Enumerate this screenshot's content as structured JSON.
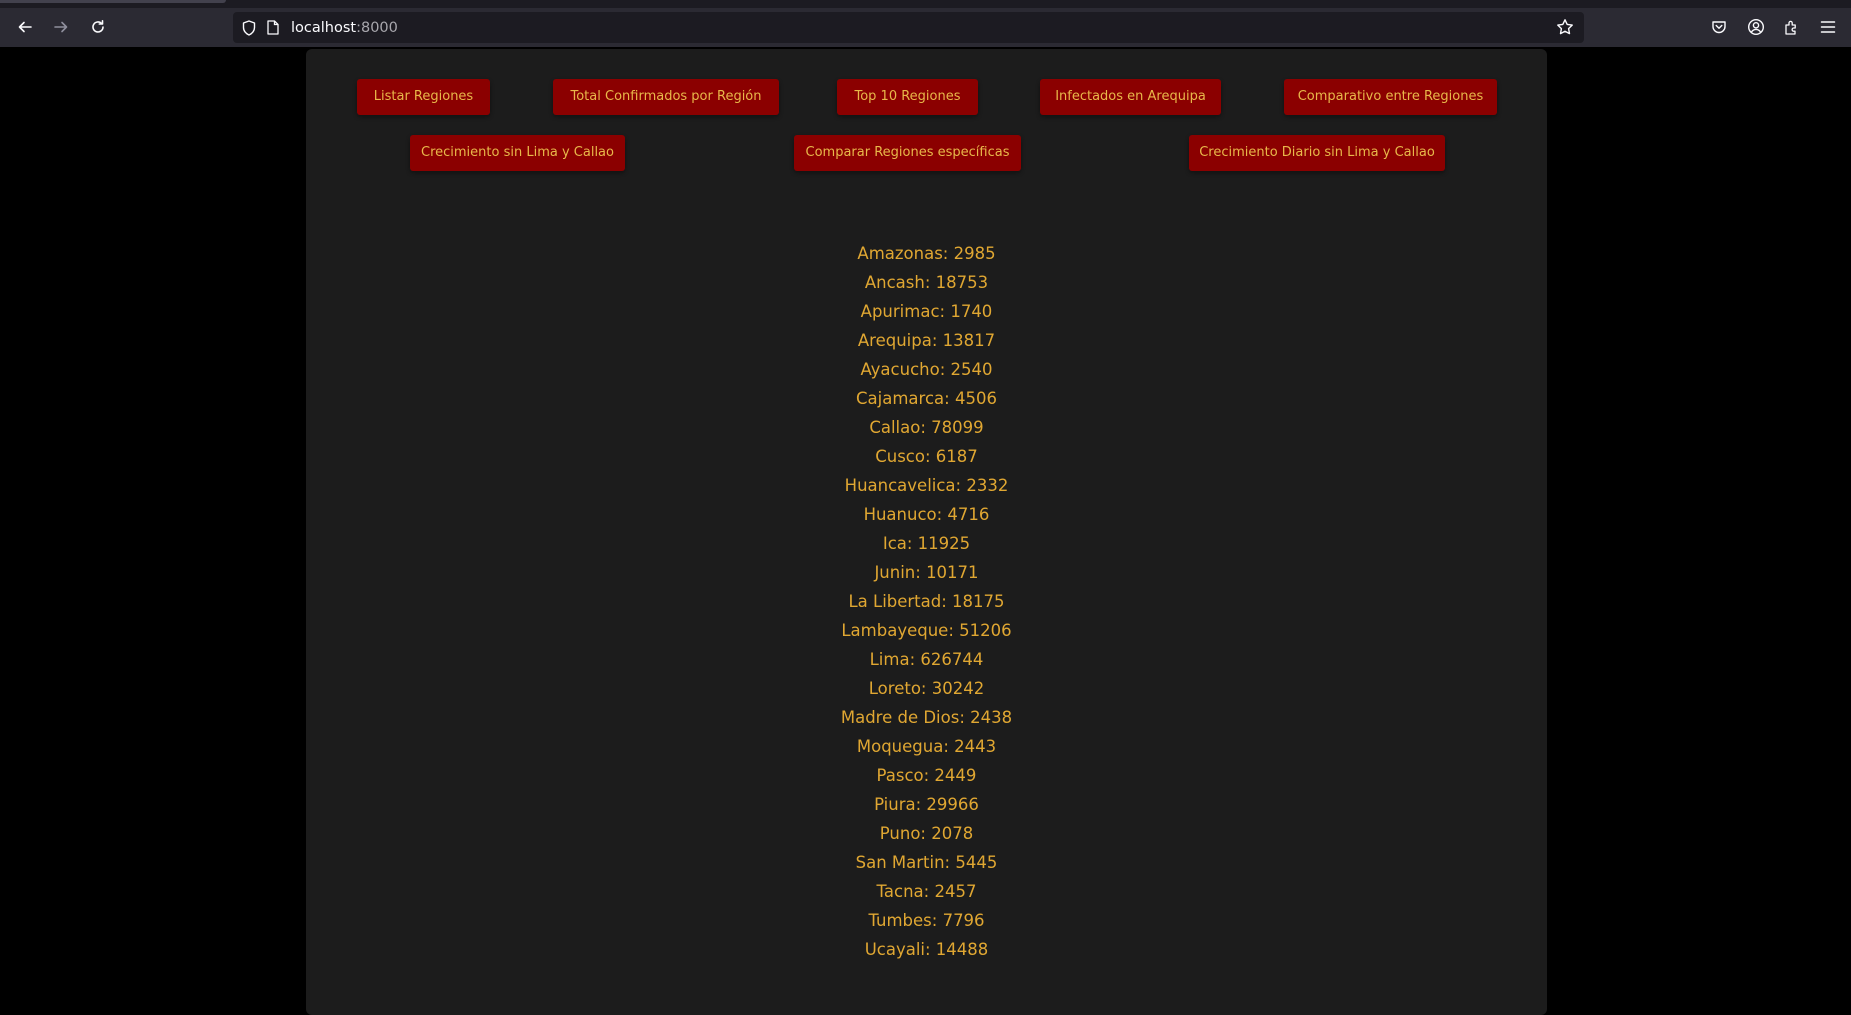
{
  "browser": {
    "url_host": "localhost",
    "url_port": ":8000"
  },
  "buttons_row1": [
    {
      "label": "Listar Regiones"
    },
    {
      "label": "Total Confirmados por Región"
    },
    {
      "label": "Top 10 Regiones"
    },
    {
      "label": "Infectados en Arequipa"
    },
    {
      "label": "Comparativo entre Regiones"
    }
  ],
  "buttons_row2": [
    {
      "label": "Crecimiento sin Lima y Callao"
    },
    {
      "label": "Comparar Regiones específicas"
    },
    {
      "label": "Crecimiento Diario sin Lima y Callao"
    }
  ],
  "regions": [
    "Amazonas: 2985",
    "Ancash: 18753",
    "Apurimac: 1740",
    "Arequipa: 13817",
    "Ayacucho: 2540",
    "Cajamarca: 4506",
    "Callao: 78099",
    "Cusco: 6187",
    "Huancavelica: 2332",
    "Huanuco: 4716",
    "Ica: 11925",
    "Junin: 10171",
    "La Libertad: 18175",
    "Lambayeque: 51206",
    "Lima: 626744",
    "Loreto: 30242",
    "Madre de Dios: 2438",
    "Moquegua: 2443",
    "Pasco: 2449",
    "Piura: 29966",
    "Puno: 2078",
    "San Martin: 5445",
    "Tacna: 2457",
    "Tumbes: 7796",
    "Ucayali: 14488"
  ],
  "colors": {
    "button_bg": "#8b0000",
    "button_text": "#e8b84a",
    "list_text": "#e0a732",
    "panel_bg": "#1c1c1c",
    "page_bg": "#000000"
  },
  "icons": {
    "back": "back-arrow-icon",
    "forward": "forward-arrow-icon",
    "reload": "reload-icon",
    "shield": "shield-icon",
    "page": "page-icon",
    "bookmark": "star-icon",
    "pocket": "pocket-icon",
    "account": "account-icon",
    "extensions": "extensions-icon",
    "menu": "hamburger-menu-icon"
  }
}
